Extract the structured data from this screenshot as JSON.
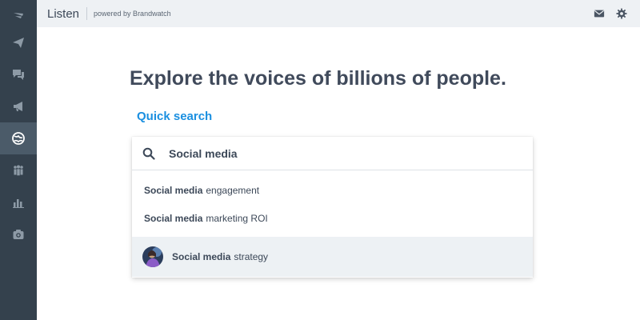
{
  "header": {
    "app_title": "Listen",
    "powered_by": "powered by Brandwatch",
    "icons": [
      "mail-icon",
      "gear-icon"
    ]
  },
  "sidebar": {
    "items": [
      {
        "icon": "logo-icon",
        "active": false
      },
      {
        "icon": "send-icon",
        "active": false
      },
      {
        "icon": "chat-icon",
        "active": false
      },
      {
        "icon": "megaphone-icon",
        "active": false
      },
      {
        "icon": "globe-icon",
        "active": true
      },
      {
        "icon": "people-icon",
        "active": false
      },
      {
        "icon": "bar-chart-icon",
        "active": false
      },
      {
        "icon": "camera-icon",
        "active": false
      }
    ]
  },
  "main": {
    "headline": "Explore the voices of billions of people.",
    "quick_search_label": "Quick search",
    "search": {
      "value": "Social media",
      "suggestions": [
        {
          "bold": "Social media",
          "rest": "engagement",
          "highlighted": false
        },
        {
          "bold": "Social media",
          "rest": "marketing ROI",
          "highlighted": false
        },
        {
          "bold": "Social media",
          "rest": "strategy",
          "highlighted": true
        }
      ]
    }
  },
  "colors": {
    "sidebar_bg": "#34414d",
    "sidebar_active": "#4b5b69",
    "topbar_bg": "#eef1f4",
    "accent": "#1a8fe0",
    "highlight_row": "#edf1f4"
  }
}
